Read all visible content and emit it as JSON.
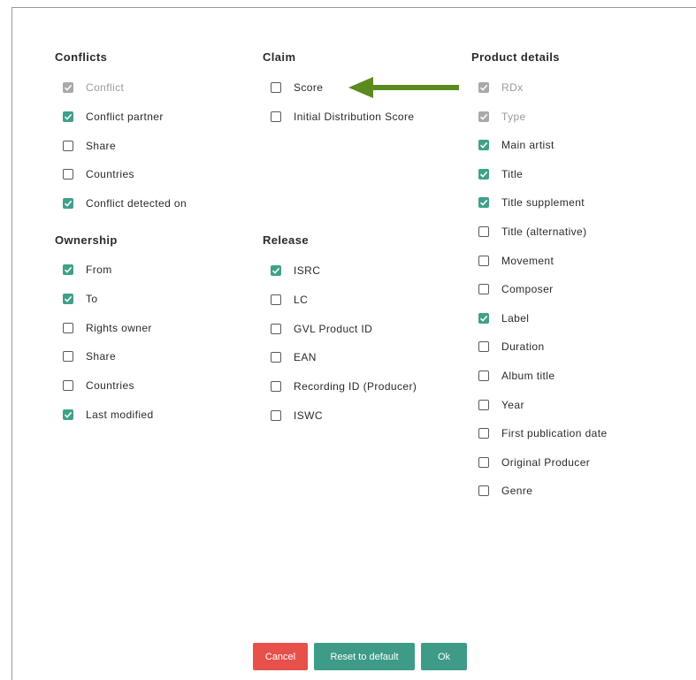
{
  "colors": {
    "accent": "#3fa18a",
    "cancel": "#e8504a",
    "arrow": "#5b8a1e",
    "disabled_check": "#a9a9a9"
  },
  "groups": {
    "conflicts": {
      "title": "Conflicts",
      "items": [
        {
          "label": "Conflict",
          "checked": true,
          "disabled": true
        },
        {
          "label": "Conflict partner",
          "checked": true,
          "disabled": false
        },
        {
          "label": "Share",
          "checked": false,
          "disabled": false
        },
        {
          "label": "Countries",
          "checked": false,
          "disabled": false
        },
        {
          "label": "Conflict detected on",
          "checked": true,
          "disabled": false
        }
      ]
    },
    "ownership": {
      "title": "Ownership",
      "items": [
        {
          "label": "From",
          "checked": true,
          "disabled": false
        },
        {
          "label": "To",
          "checked": true,
          "disabled": false
        },
        {
          "label": "Rights owner",
          "checked": false,
          "disabled": false
        },
        {
          "label": "Share",
          "checked": false,
          "disabled": false
        },
        {
          "label": "Countries",
          "checked": false,
          "disabled": false
        },
        {
          "label": "Last modified",
          "checked": true,
          "disabled": false
        }
      ]
    },
    "claim": {
      "title": "Claim",
      "items": [
        {
          "label": "Score",
          "checked": false,
          "disabled": false
        },
        {
          "label": "Initial Distribution Score",
          "checked": false,
          "disabled": false
        }
      ]
    },
    "release": {
      "title": "Release",
      "items": [
        {
          "label": "ISRC",
          "checked": true,
          "disabled": false
        },
        {
          "label": "LC",
          "checked": false,
          "disabled": false
        },
        {
          "label": "GVL Product ID",
          "checked": false,
          "disabled": false
        },
        {
          "label": "EAN",
          "checked": false,
          "disabled": false
        },
        {
          "label": "Recording ID (Producer)",
          "checked": false,
          "disabled": false
        },
        {
          "label": "ISWC",
          "checked": false,
          "disabled": false
        }
      ]
    },
    "product_details": {
      "title": "Product details",
      "items": [
        {
          "label": "RDx",
          "checked": true,
          "disabled": true
        },
        {
          "label": "Type",
          "checked": true,
          "disabled": true
        },
        {
          "label": "Main artist",
          "checked": true,
          "disabled": false
        },
        {
          "label": "Title",
          "checked": true,
          "disabled": false
        },
        {
          "label": "Title supplement",
          "checked": true,
          "disabled": false
        },
        {
          "label": "Title (alternative)",
          "checked": false,
          "disabled": false
        },
        {
          "label": "Movement",
          "checked": false,
          "disabled": false
        },
        {
          "label": "Composer",
          "checked": false,
          "disabled": false
        },
        {
          "label": "Label",
          "checked": true,
          "disabled": false
        },
        {
          "label": "Duration",
          "checked": false,
          "disabled": false
        },
        {
          "label": "Album title",
          "checked": false,
          "disabled": false
        },
        {
          "label": "Year",
          "checked": false,
          "disabled": false
        },
        {
          "label": "First publication date",
          "checked": false,
          "disabled": false
        },
        {
          "label": "Original Producer",
          "checked": false,
          "disabled": false
        },
        {
          "label": "Genre",
          "checked": false,
          "disabled": false
        }
      ]
    }
  },
  "arrow_icon": "arrow-left-icon",
  "buttons": {
    "cancel": "Cancel",
    "reset": "Reset to default",
    "ok": "Ok"
  }
}
